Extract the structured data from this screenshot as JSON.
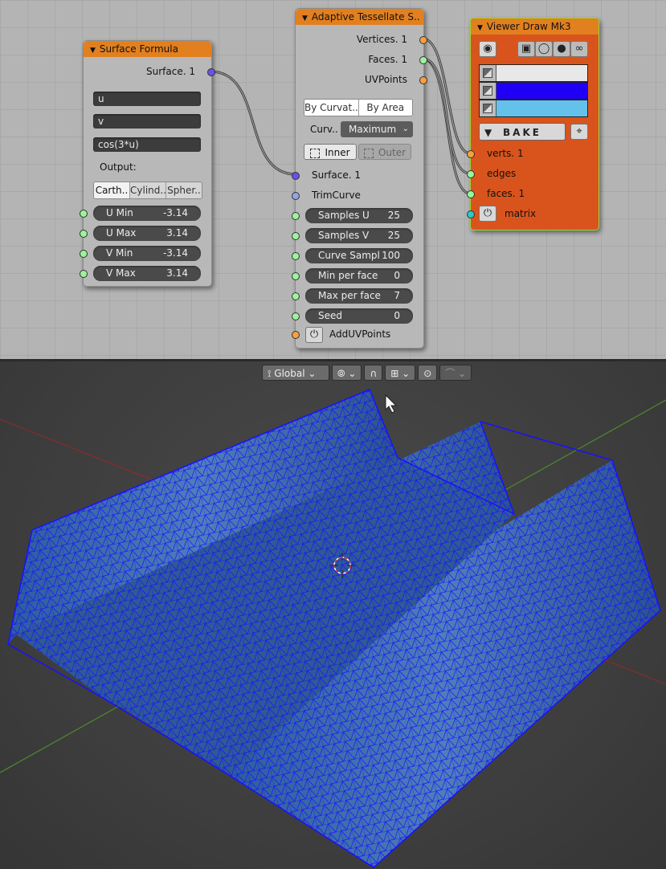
{
  "surface_formula": {
    "title": "Surface Formula",
    "output_socket": "Surface. 1",
    "fields": [
      "u",
      "v",
      "cos(3*u)"
    ],
    "output_label": "Output:",
    "modes": [
      "Carth..",
      "Cylind..",
      "Spher.."
    ],
    "params": [
      {
        "label": "U Min",
        "value": "-3.14"
      },
      {
        "label": "U Max",
        "value": "3.14"
      },
      {
        "label": "V Min",
        "value": "-3.14"
      },
      {
        "label": "V Max",
        "value": "3.14"
      }
    ]
  },
  "adaptive_tessellate": {
    "title": "Adaptive Tessellate S..",
    "outputs": [
      "Vertices. 1",
      "Faces. 1",
      "UVPoints"
    ],
    "modes": [
      "By Curvat..",
      "By Area"
    ],
    "curv_label": "Curv..",
    "curv_value": "Maximum",
    "inner_label": "Inner",
    "outer_label": "Outer",
    "inputs": [
      "Surface. 1",
      "TrimCurve"
    ],
    "params": [
      {
        "label": "Samples U",
        "value": "25"
      },
      {
        "label": "Samples V",
        "value": "25"
      },
      {
        "label": "Curve Sampl",
        "value": "100"
      },
      {
        "label": "Min per face",
        "value": "0"
      },
      {
        "label": "Max per face",
        "value": "7"
      },
      {
        "label": "Seed",
        "value": "0"
      }
    ],
    "add_uv_label": "AddUVPoints"
  },
  "viewer_draw": {
    "title": "Viewer Draw Mk3",
    "colors": {
      "vertex": "#e8e8e8",
      "edge": "#1f00f5",
      "face": "#63c1ec"
    },
    "bake_label": "BAKE",
    "inputs": [
      "verts. 1",
      "edges",
      "faces. 1",
      "matrix"
    ]
  },
  "viewport": {
    "orientation": "Global",
    "mesh_edge_color": "#1a10ff",
    "mesh_face_color": "#3a6aa8"
  }
}
